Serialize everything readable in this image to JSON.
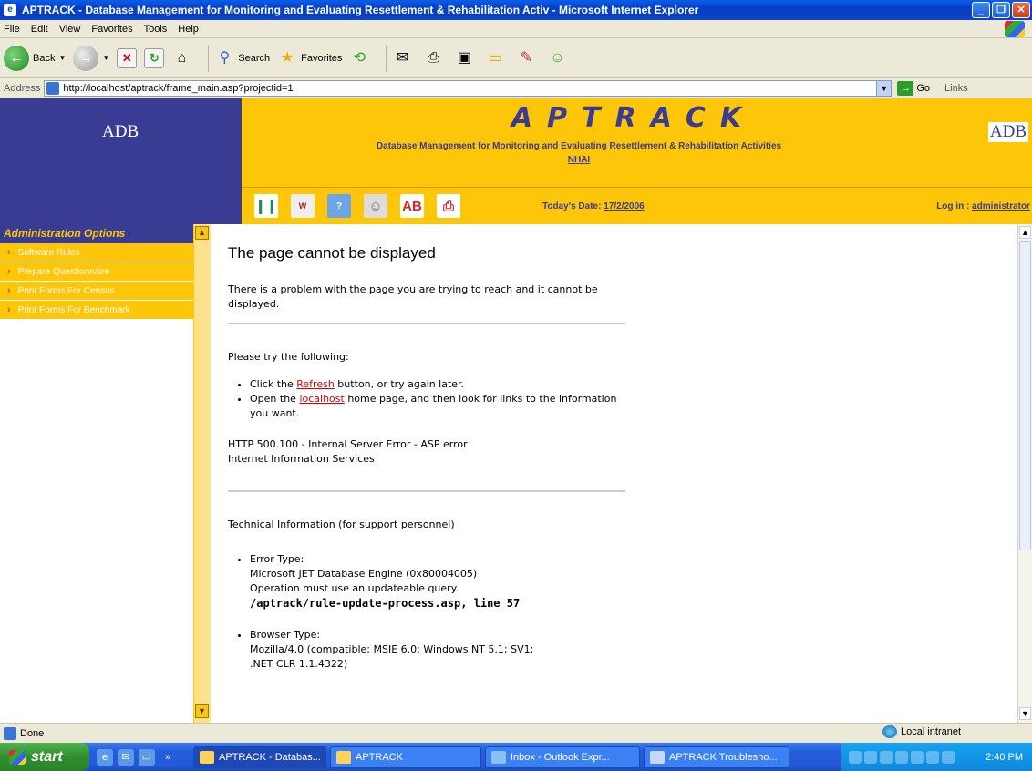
{
  "window": {
    "title": "APTRACK - Database Management for Monitoring and Evaluating Resettlement & Rehabilitation Activ - Microsoft Internet Explorer"
  },
  "menu": [
    "File",
    "Edit",
    "View",
    "Favorites",
    "Tools",
    "Help"
  ],
  "toolbar": {
    "back_label": "Back",
    "search_label": "Search",
    "favorites_label": "Favorites"
  },
  "address": {
    "label": "Address",
    "url": "http://localhost/aptrack/frame_main.asp?projectid=1",
    "go_label": "Go",
    "links_label": "Links"
  },
  "header": {
    "logo_left": "ADB",
    "logo_right": "ADB",
    "app_name": "APTRACK",
    "subtitle": "Database Management for Monitoring and Evaluating Resettlement & Rehabilitation Activities",
    "org": "NHAI",
    "date_label": "Today's Date: ",
    "date_value": "17/2/2006",
    "login_label": "Log in : ",
    "login_value": "administrator"
  },
  "sidebar": {
    "heading": "Administration Options",
    "items": [
      {
        "label": "Software Rules"
      },
      {
        "label": "Prepare Questionnaire"
      },
      {
        "label": "Print Forms For Census"
      },
      {
        "label": "Print Forms For Benchmark"
      }
    ]
  },
  "error": {
    "title": "The page cannot be displayed",
    "intro": "There is a problem with the page you are trying to reach and it cannot be displayed.",
    "try_heading": "Please try the following:",
    "bullet1_pre": "Click the ",
    "bullet1_link": "Refresh",
    "bullet1_post": " button, or try again later.",
    "bullet2_pre": "Open the ",
    "bullet2_link": "localhost",
    "bullet2_post": " home page, and then look for links to the information you want.",
    "http_line1": "HTTP 500.100 - Internal Server Error - ASP error",
    "http_line2": "Internet Information Services",
    "tech_heading": "Technical Information (for support personnel)",
    "err_type_label": "Error Type:",
    "err_type_line1": "Microsoft JET Database Engine (0x80004005)",
    "err_type_line2": "Operation must use an updateable query.",
    "err_type_line3": "/aptrack/rule-update-process.asp, line 57",
    "browser_label": "Browser Type:",
    "browser_line1": "Mozilla/4.0 (compatible; MSIE 6.0; Windows NT 5.1; SV1;",
    "browser_line2": ".NET CLR 1.1.4322)"
  },
  "status": {
    "text": "Done",
    "zone": "Local intranet"
  },
  "taskbar": {
    "start_label": "start",
    "tasks": [
      {
        "label": "APTRACK - Databas..."
      },
      {
        "label": "APTRACK"
      },
      {
        "label": "Inbox - Outlook Expr..."
      },
      {
        "label": "APTRACK Troublesho..."
      }
    ],
    "clock": "2:40 PM"
  }
}
